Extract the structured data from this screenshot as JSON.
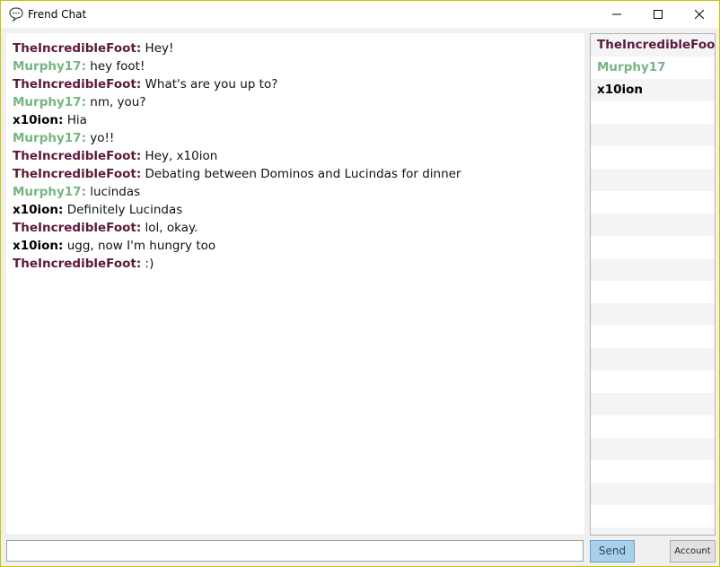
{
  "window": {
    "title": "Frend Chat",
    "icon": "speech-bubble-icon"
  },
  "colors": {
    "TheIncredibleFoot": "#5c1a3a",
    "Murphy17": "#77b582",
    "x10ion": "#000000"
  },
  "messages": [
    {
      "user": "TheIncredibleFoot:",
      "text": " Hey!"
    },
    {
      "user": "Murphy17:",
      "text": " hey foot!"
    },
    {
      "user": "TheIncredibleFoot:",
      "text": " What's are you up to?"
    },
    {
      "user": "Murphy17:",
      "text": " nm, you?"
    },
    {
      "user": "x10ion:",
      "text": " Hia"
    },
    {
      "user": "Murphy17:",
      "text": " yo!!"
    },
    {
      "user": "TheIncredibleFoot:",
      "text": " Hey, x10ion"
    },
    {
      "user": "TheIncredibleFoot:",
      "text": " Debating between Dominos and Lucindas for dinner"
    },
    {
      "user": "Murphy17:",
      "text": " lucindas"
    },
    {
      "user": "x10ion:",
      "text": " Definitely Lucindas"
    },
    {
      "user": "TheIncredibleFoot:",
      "text": " lol, okay."
    },
    {
      "user": "x10ion:",
      "text": " ugg, now I'm hungry too"
    },
    {
      "user": "TheIncredibleFoot:",
      "text": " :)"
    }
  ],
  "users": [
    "TheIncredibleFoot",
    "Murphy17",
    "x10ion"
  ],
  "input": {
    "value": "",
    "placeholder": ""
  },
  "buttons": {
    "send": "Send",
    "account": "Account"
  }
}
